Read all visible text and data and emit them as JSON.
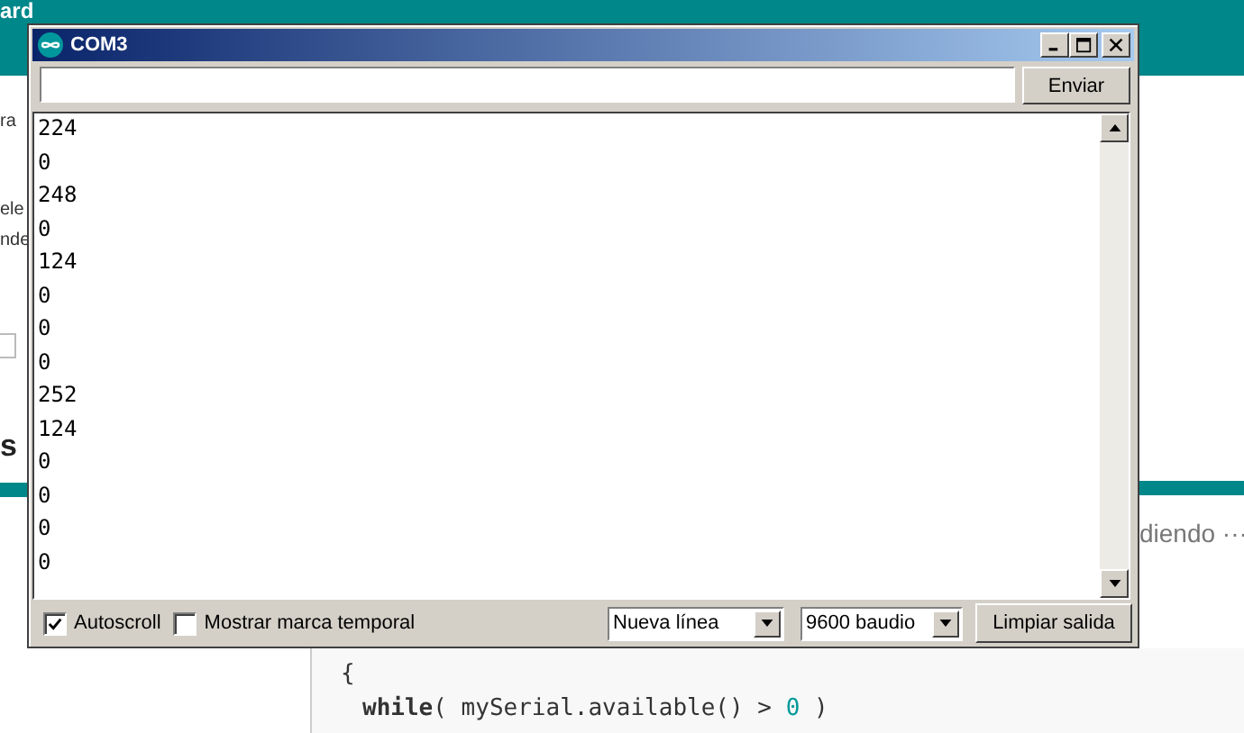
{
  "background_page": {
    "header_text": "ard",
    "left_fragments": [
      "ra",
      "ele",
      "nde"
    ],
    "left_heading": "s",
    "right_text": "diendo ···",
    "code_lines": [
      {
        "kind": "plain",
        "text": "{"
      },
      {
        "kind": "call",
        "keyword": "while",
        "rest": "( mySerial.available() > ",
        "number": "0",
        "end": " )"
      }
    ]
  },
  "window": {
    "title": "COM3",
    "send_button": "Enviar",
    "output_lines": [
      "224",
      "0",
      "248",
      "0",
      "124",
      "0",
      "0",
      "0",
      "252",
      "124",
      "0",
      "0",
      "0",
      "0"
    ],
    "autoscroll": {
      "label": "Autoscroll",
      "checked": true
    },
    "timestamp": {
      "label": "Mostrar marca temporal",
      "checked": false
    },
    "line_ending": "Nueva línea",
    "baud_rate": "9600 baudio",
    "clear_button": "Limpiar salida"
  }
}
